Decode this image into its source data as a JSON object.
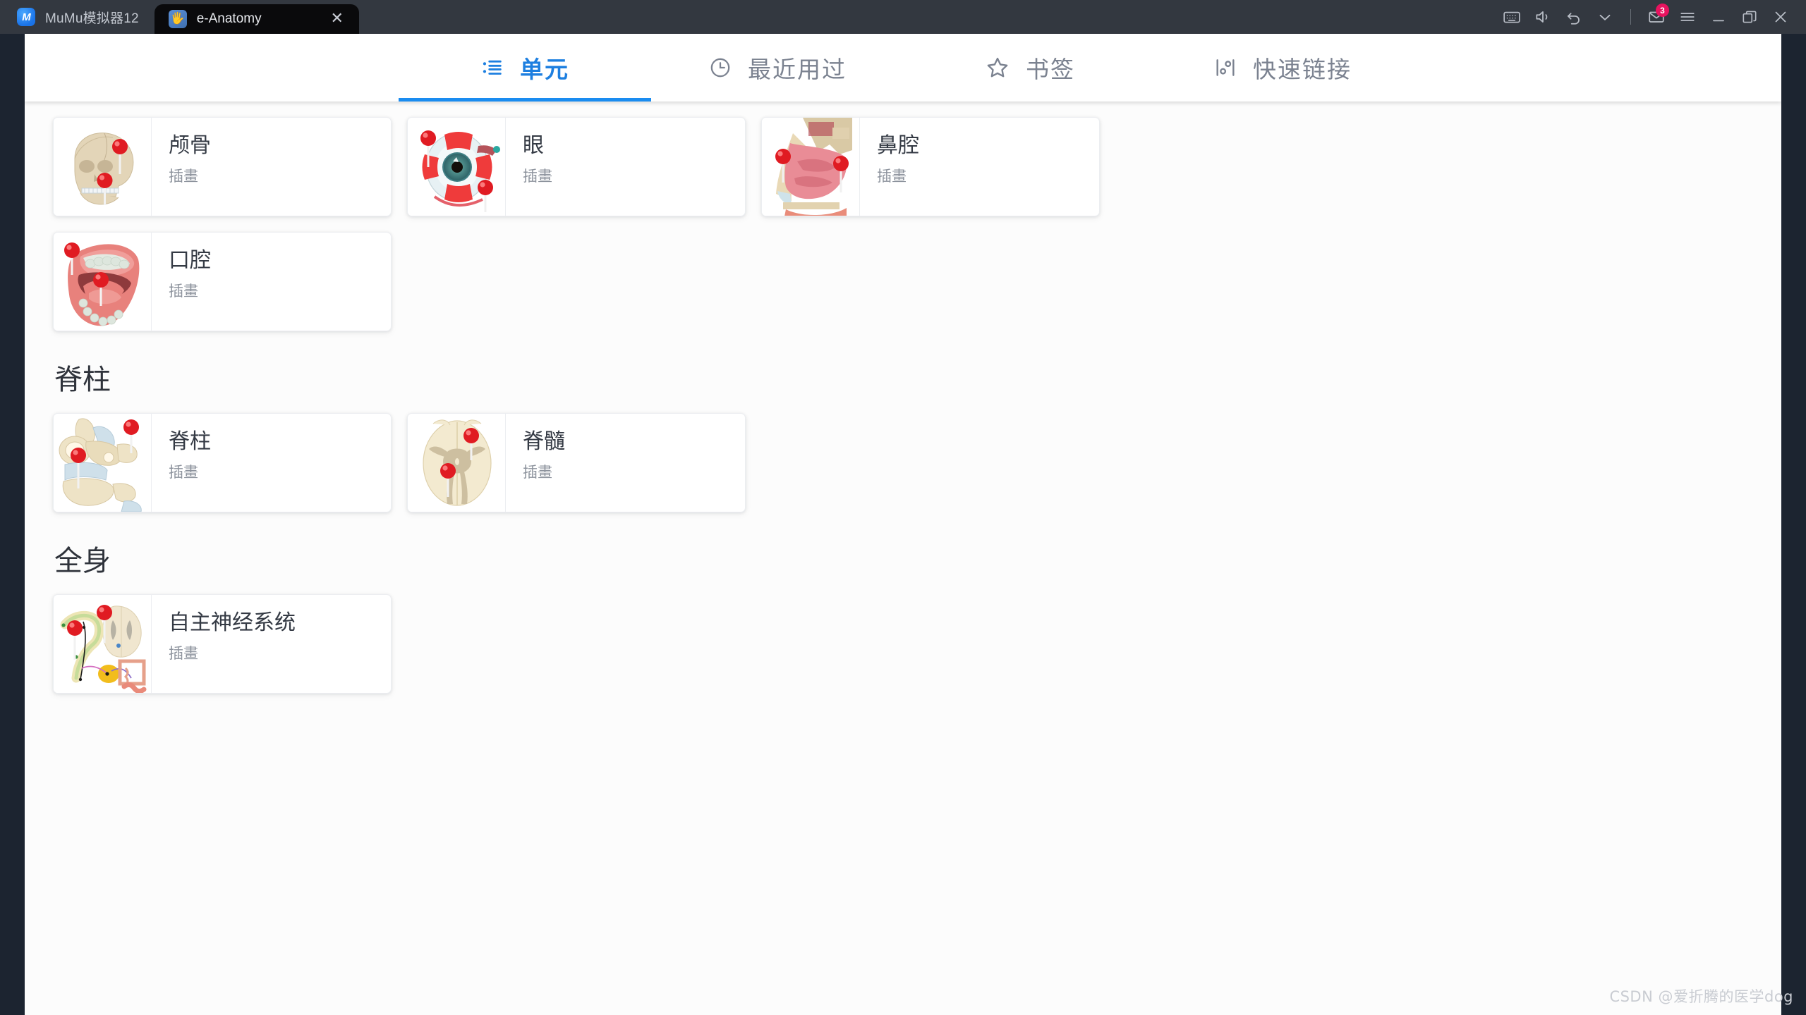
{
  "emulator": {
    "name": "MuMu模拟器12",
    "logo_icon": "mumu-logo-icon",
    "tab": {
      "title": "e-Anatomy",
      "icon": "hand-app-icon",
      "close_label": "✕"
    },
    "controls": [
      {
        "name": "keyboard-icon",
        "label": ""
      },
      {
        "name": "volume-icon",
        "label": ""
      },
      {
        "name": "back-undo-icon",
        "label": ""
      },
      {
        "name": "chevron-down-icon",
        "label": ""
      },
      {
        "name": "separator",
        "label": ""
      },
      {
        "name": "mail-icon",
        "label": "",
        "badge": "3"
      },
      {
        "name": "hamburger-menu-icon",
        "label": ""
      },
      {
        "name": "minimize-icon",
        "label": ""
      },
      {
        "name": "maximize-icon",
        "label": ""
      },
      {
        "name": "close-icon",
        "label": ""
      }
    ],
    "badge_color": "#e8135f"
  },
  "app": {
    "accent_color": "#1a8cf0",
    "tabs": [
      {
        "label": "单元",
        "icon": "list-bullets-icon",
        "active": true
      },
      {
        "label": "最近用过",
        "icon": "clock-icon",
        "active": false
      },
      {
        "label": "书签",
        "icon": "star-icon",
        "active": false
      },
      {
        "label": "快速链接",
        "icon": "sliders-icon",
        "active": false
      }
    ],
    "sections": [
      {
        "title": "",
        "cards": [
          {
            "title": "颅骨",
            "subtitle": "插畫",
            "thumb": "skull-thumb"
          },
          {
            "title": "眼",
            "subtitle": "插畫",
            "thumb": "eye-thumb"
          },
          {
            "title": "鼻腔",
            "subtitle": "插畫",
            "thumb": "nose-thumb"
          },
          {
            "title": "口腔",
            "subtitle": "插畫",
            "thumb": "mouth-thumb"
          }
        ]
      },
      {
        "title": "脊柱",
        "cards": [
          {
            "title": "脊柱",
            "subtitle": "插畫",
            "thumb": "vertebra-thumb"
          },
          {
            "title": "脊髓",
            "subtitle": "插畫",
            "thumb": "spinalcord-thumb"
          }
        ]
      },
      {
        "title": "全身",
        "cards": [
          {
            "title": "自主神经系统",
            "subtitle": "插畫",
            "thumb": "ans-thumb"
          }
        ]
      }
    ]
  },
  "watermark": "CSDN @爱折腾的医学dog"
}
